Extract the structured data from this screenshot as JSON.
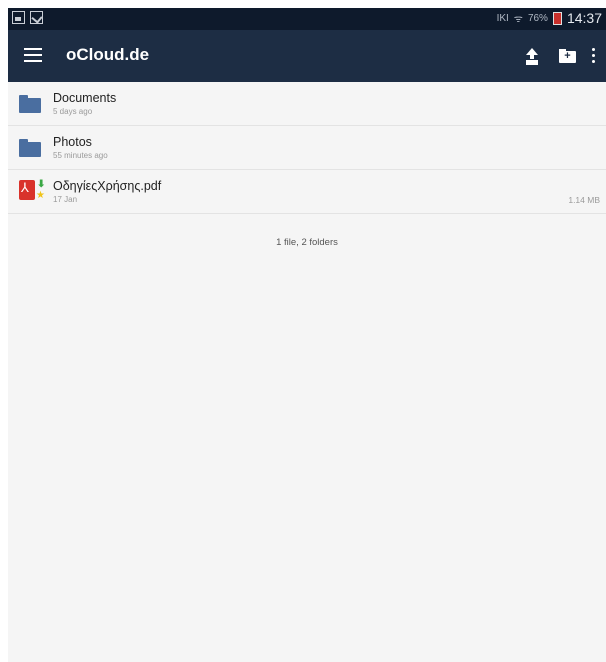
{
  "status_bar": {
    "left_icons": [
      "gallery-icon",
      "clipboard-icon"
    ],
    "signal_text": "ΙΚΙ",
    "battery": "76%",
    "time": "14:37"
  },
  "app_bar": {
    "title": "oCloud.de",
    "actions": [
      "upload-icon",
      "new-folder-icon",
      "more-options-icon"
    ]
  },
  "files": [
    {
      "name": "Documents",
      "meta": "5 days ago",
      "type": "folder",
      "size": ""
    },
    {
      "name": "Photos",
      "meta": "55 minutes ago",
      "type": "folder",
      "size": ""
    },
    {
      "name": "ΟδηγίεςΧρήσης.pdf",
      "meta": "17 Jan",
      "type": "pdf",
      "size": "1.14 MB"
    }
  ],
  "summary": "1 file, 2 folders",
  "colors": {
    "app_bar": "#1d2d44",
    "status_bar": "#0e1a2c",
    "folder": "#4a6ea0",
    "pdf": "#d9322b",
    "background": "#f5f5f5"
  }
}
